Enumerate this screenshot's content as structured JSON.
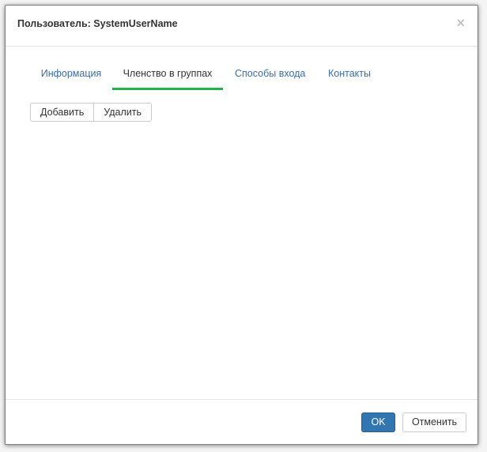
{
  "dialog": {
    "title": "Пользователь: SystemUserName",
    "close_glyph": "×"
  },
  "tabs": [
    {
      "label": "Информация",
      "active": false
    },
    {
      "label": "Членство в группах",
      "active": true
    },
    {
      "label": "Способы входа",
      "active": false
    },
    {
      "label": "Контакты",
      "active": false
    }
  ],
  "toolbar": {
    "add_label": "Добавить",
    "remove_label": "Удалить"
  },
  "footer": {
    "ok_label": "OK",
    "cancel_label": "Отменить"
  },
  "colors": {
    "accent_tab_underline": "#22b14c",
    "link": "#3a6ea5",
    "primary_button": "#3276b1"
  }
}
